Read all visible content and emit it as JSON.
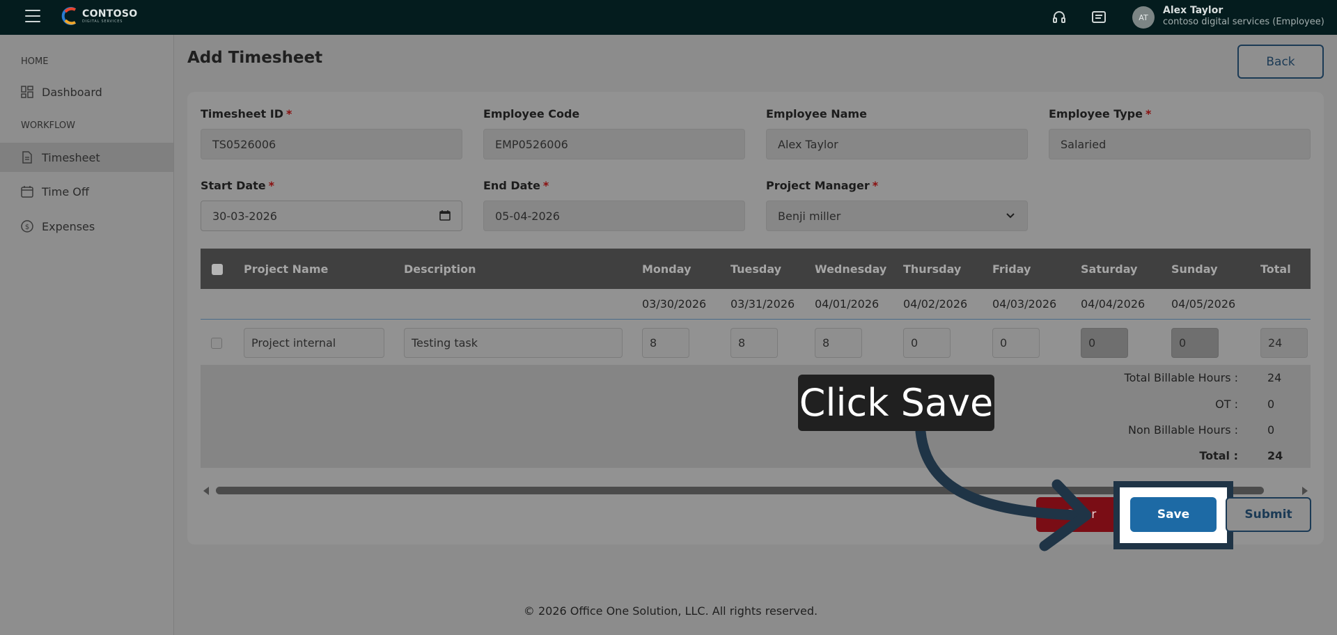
{
  "app": {
    "brand_name": "CONTOSO",
    "brand_sub": "DIGITAL SERVICES",
    "user_initials": "AT",
    "user_name": "Alex Taylor",
    "user_org": "contoso digital services (Employee)"
  },
  "sidebar": {
    "home_section": "HOME",
    "workflow_section": "WORKFLOW",
    "items": [
      {
        "label": "Dashboard",
        "icon": "dashboard-icon"
      },
      {
        "label": "Timesheet",
        "icon": "document-icon",
        "active": true
      },
      {
        "label": "Time Off",
        "icon": "calendar-icon"
      },
      {
        "label": "Expenses",
        "icon": "dollar-icon"
      }
    ]
  },
  "page": {
    "title": "Add Timesheet",
    "back_label": "Back"
  },
  "form": {
    "timesheet_id": {
      "label": "Timesheet ID",
      "value": "TS0526006"
    },
    "employee_code": {
      "label": "Employee Code",
      "value": "EMP0526006"
    },
    "employee_name": {
      "label": "Employee Name",
      "value": "Alex Taylor"
    },
    "employee_type": {
      "label": "Employee Type",
      "value": "Salaried"
    },
    "start_date": {
      "label": "Start Date",
      "value": "30-03-2026"
    },
    "end_date": {
      "label": "End Date",
      "value": "05-04-2026"
    },
    "project_manager": {
      "label": "Project Manager",
      "value": "Benji miller"
    },
    "required_mark": "*"
  },
  "grid": {
    "headers": [
      "Project Name",
      "Description",
      "Monday",
      "Tuesday",
      "Wednesday",
      "Thursday",
      "Friday",
      "Saturday",
      "Sunday",
      "Total"
    ],
    "dates": [
      "03/30/2026",
      "03/31/2026",
      "04/01/2026",
      "04/02/2026",
      "04/03/2026",
      "04/04/2026",
      "04/05/2026"
    ],
    "row": {
      "project": "Project internal",
      "description": "Testing task",
      "hours": [
        "8",
        "8",
        "8",
        "0",
        "0",
        "0",
        "0"
      ],
      "total": "24"
    }
  },
  "summary": {
    "billable_label": "Total Billable Hours :",
    "billable_value": "24",
    "ot_label": "OT :",
    "ot_value": "0",
    "non_billable_label": "Non Billable Hours :",
    "non_billable_value": "0",
    "total_label": "Total :",
    "total_value": "24"
  },
  "actions": {
    "clear_label": "Clear",
    "save_label": "Save",
    "submit_label": "Submit"
  },
  "guide": {
    "callout": "Click Save"
  },
  "footer": {
    "text": "© 2026 Office One Solution, LLC. All rights reserved."
  },
  "colors": {
    "topbar": "#041c1e",
    "save_button": "#1d6aa5",
    "clear_button": "#7a0d15",
    "accent_navy": "#1b3a55",
    "required": "#8a0f0f"
  }
}
